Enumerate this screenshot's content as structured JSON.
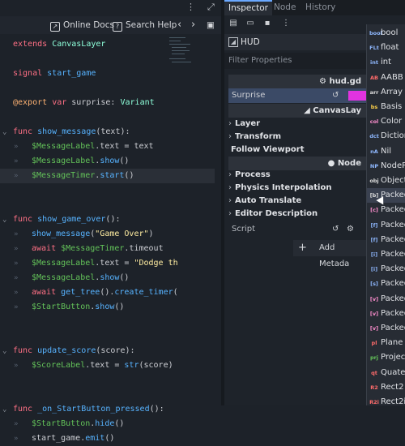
{
  "editor": {
    "toolbar": {
      "online_docs": "Online Docs",
      "search_help": "Search Help",
      "prev": "‹",
      "next": "›"
    },
    "lines": [
      {
        "tokens": [
          [
            "kw",
            "extends"
          ],
          [
            "tx",
            " "
          ],
          [
            "ty",
            "CanvasLayer"
          ]
        ]
      },
      {
        "tokens": []
      },
      {
        "tokens": [
          [
            "kw",
            "signal"
          ],
          [
            "tx",
            " "
          ],
          [
            "fn",
            "start_game"
          ]
        ]
      },
      {
        "tokens": []
      },
      {
        "tokens": [
          [
            "an",
            "@export"
          ],
          [
            "tx",
            " "
          ],
          [
            "kw",
            "var"
          ],
          [
            "tx",
            " surprise: "
          ],
          [
            "ty",
            "Variant"
          ]
        ]
      },
      {
        "tokens": []
      },
      {
        "fold": true,
        "tokens": [
          [
            "kw",
            "func"
          ],
          [
            "tx",
            " "
          ],
          [
            "fn",
            "show_message"
          ],
          [
            "tx",
            "(text):"
          ]
        ]
      },
      {
        "indent": 1,
        "tokens": [
          [
            "nd",
            "$MessageLabel"
          ],
          [
            "tx",
            ".text = text"
          ]
        ]
      },
      {
        "indent": 1,
        "tokens": [
          [
            "nd",
            "$MessageLabel"
          ],
          [
            "tx",
            "."
          ],
          [
            "fn",
            "show"
          ],
          [
            "tx",
            "()"
          ]
        ]
      },
      {
        "indent": 1,
        "hl": true,
        "tokens": [
          [
            "nd",
            "$MessageTimer"
          ],
          [
            "tx",
            "."
          ],
          [
            "fn",
            "start"
          ],
          [
            "tx",
            "()"
          ]
        ]
      },
      {
        "tokens": []
      },
      {
        "tokens": []
      },
      {
        "fold": true,
        "tokens": [
          [
            "kw",
            "func"
          ],
          [
            "tx",
            " "
          ],
          [
            "fn",
            "show_game_over"
          ],
          [
            "tx",
            "():"
          ]
        ]
      },
      {
        "indent": 1,
        "tokens": [
          [
            "fn",
            "show_message"
          ],
          [
            "tx",
            "("
          ],
          [
            "st",
            "\"Game Over\""
          ],
          [
            "tx",
            ")"
          ]
        ]
      },
      {
        "indent": 1,
        "tokens": [
          [
            "kw",
            "await"
          ],
          [
            "tx",
            " "
          ],
          [
            "nd",
            "$MessageTimer"
          ],
          [
            "tx",
            ".timeout"
          ]
        ]
      },
      {
        "indent": 1,
        "tokens": [
          [
            "nd",
            "$MessageLabel"
          ],
          [
            "tx",
            ".text = "
          ],
          [
            "st",
            "\"Dodge th"
          ]
        ]
      },
      {
        "indent": 1,
        "tokens": [
          [
            "nd",
            "$MessageLabel"
          ],
          [
            "tx",
            "."
          ],
          [
            "fn",
            "show"
          ],
          [
            "tx",
            "()"
          ]
        ]
      },
      {
        "indent": 1,
        "tokens": [
          [
            "kw",
            "await"
          ],
          [
            "tx",
            " "
          ],
          [
            "fn",
            "get_tree"
          ],
          [
            "tx",
            "()."
          ],
          [
            "fn",
            "create_timer"
          ],
          [
            "tx",
            "("
          ]
        ]
      },
      {
        "indent": 1,
        "tokens": [
          [
            "nd",
            "$StartButton"
          ],
          [
            "tx",
            "."
          ],
          [
            "fn",
            "show"
          ],
          [
            "tx",
            "()"
          ]
        ]
      },
      {
        "tokens": []
      },
      {
        "tokens": []
      },
      {
        "fold": true,
        "tokens": [
          [
            "kw",
            "func"
          ],
          [
            "tx",
            " "
          ],
          [
            "fn",
            "update_score"
          ],
          [
            "tx",
            "(score):"
          ]
        ]
      },
      {
        "indent": 1,
        "tokens": [
          [
            "nd",
            "$ScoreLabel"
          ],
          [
            "tx",
            ".text = "
          ],
          [
            "fn",
            "str"
          ],
          [
            "tx",
            "(score)"
          ]
        ]
      },
      {
        "tokens": []
      },
      {
        "tokens": []
      },
      {
        "fold": true,
        "tokens": [
          [
            "kw",
            "func"
          ],
          [
            "tx",
            " "
          ],
          [
            "fn",
            "_on_StartButton_pressed"
          ],
          [
            "tx",
            "():"
          ]
        ]
      },
      {
        "indent": 1,
        "tokens": [
          [
            "nd",
            "$StartButton"
          ],
          [
            "tx",
            "."
          ],
          [
            "fn",
            "hide"
          ],
          [
            "tx",
            "()"
          ]
        ]
      },
      {
        "indent": 1,
        "tokens": [
          [
            "tx",
            "start_game."
          ],
          [
            "fn",
            "emit"
          ],
          [
            "tx",
            "()"
          ]
        ]
      }
    ]
  },
  "inspector": {
    "tabs": [
      "Inspector",
      "Node",
      "History"
    ],
    "object_name": "HUD",
    "filter_placeholder": "Filter Properties",
    "script_header": "hud.gd",
    "surprise_label": "Surprise",
    "canvaslayer_header": "CanvasLay",
    "categories_a": [
      "Layer",
      "Transform"
    ],
    "follow_viewport": "Follow Viewport",
    "node_header": "Node",
    "categories_b": [
      "Process",
      "Physics Interpolation",
      "Auto Translate",
      "Editor Description"
    ],
    "script_label": "Script",
    "add_metadata": "Add Metada",
    "colors": {
      "surprise_swatch": "#e233e0",
      "accent": "#6aa8ff"
    }
  },
  "type_dropdown": {
    "items": [
      {
        "icon": "bool",
        "label": "bool",
        "color": "#8fb8ff"
      },
      {
        "icon": "FLt",
        "label": "float",
        "color": "#8fb8ff"
      },
      {
        "icon": "int",
        "label": "int",
        "color": "#8fb8ff"
      },
      {
        "icon": "AB",
        "label": "AABB",
        "color": "#ff6b6b"
      },
      {
        "icon": "arr",
        "label": "Array",
        "color": "#dddddd"
      },
      {
        "icon": "bs",
        "label": "Basis",
        "color": "#ffd24a"
      },
      {
        "icon": "col",
        "label": "Color",
        "color": "#ff8fd0"
      },
      {
        "icon": "dct",
        "label": "Diction",
        "color": "#8fb8ff"
      },
      {
        "icon": "nA",
        "label": "Nil",
        "color": "#8fb8ff"
      },
      {
        "icon": "NP",
        "label": "NodePa",
        "color": "#8fb8ff"
      },
      {
        "icon": "obj",
        "label": "Object",
        "color": "#dddddd"
      },
      {
        "icon": "[b]",
        "label": "Packed",
        "color": "#dddddd",
        "hover": true
      },
      {
        "icon": "[c]",
        "label": "Packed",
        "color": "#ff8fd0"
      },
      {
        "icon": "[f]",
        "label": "Packed",
        "color": "#8fb8ff"
      },
      {
        "icon": "[f]",
        "label": "Packed",
        "color": "#8fb8ff"
      },
      {
        "icon": "[i]",
        "label": "Packed",
        "color": "#8fb8ff"
      },
      {
        "icon": "[i]",
        "label": "Packed",
        "color": "#8fb8ff"
      },
      {
        "icon": "[s]",
        "label": "Packed",
        "color": "#8fb8ff"
      },
      {
        "icon": "[v]",
        "label": "Packed",
        "color": "#ff8fd0"
      },
      {
        "icon": "[v]",
        "label": "Packed",
        "color": "#ff8fd0"
      },
      {
        "icon": "[v]",
        "label": "Packed",
        "color": "#ff8fd0"
      },
      {
        "icon": "pl",
        "label": "Plane",
        "color": "#ff6b6b"
      },
      {
        "icon": "prj",
        "label": "Projecti",
        "color": "#63c259"
      },
      {
        "icon": "qt",
        "label": "Quatern",
        "color": "#ff6b6b"
      },
      {
        "icon": "R2",
        "label": "Rect2",
        "color": "#ff6b6b"
      },
      {
        "icon": "R2i",
        "label": "Rect2i",
        "color": "#ff6b6b"
      }
    ]
  }
}
